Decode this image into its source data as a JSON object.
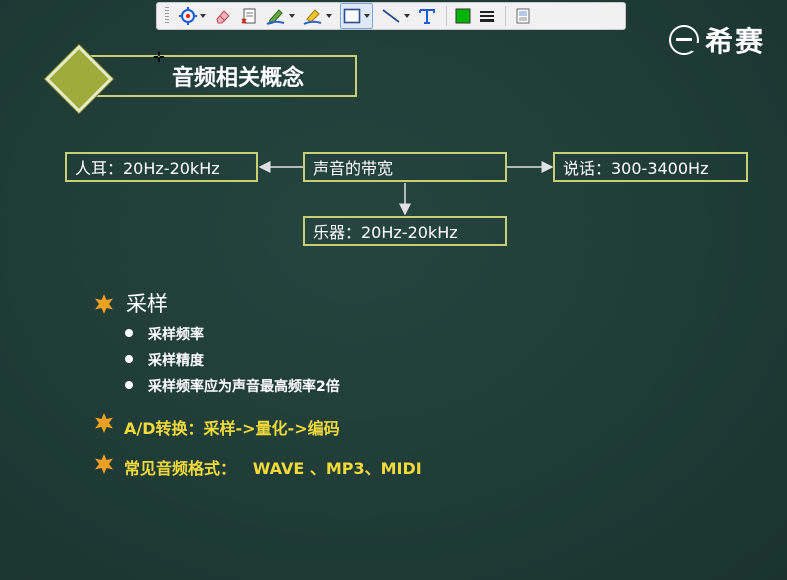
{
  "toolbar": {
    "tools": [
      "pointer-tool",
      "eraser-tool",
      "clear-slide-tool",
      "pen-tool",
      "highlighter-tool",
      "rectangle-tool",
      "line-tool",
      "text-tool",
      "color-swatch",
      "line-weight-tool",
      "screen-capture-tool"
    ],
    "colors": {
      "swatch": "#00b400",
      "accent": "#3b6fd8"
    }
  },
  "logo": {
    "text": "希赛"
  },
  "slide": {
    "title": "音频相关概念",
    "diagram": {
      "center": "声音的带宽",
      "left": "人耳：20Hz-20kHz",
      "right": "说话：300-3400Hz",
      "bottom": "乐器：20Hz-20kHz"
    },
    "sampling": {
      "heading": "采样",
      "items": [
        "采样频率",
        "采样精度",
        "采样频率应为声音最高频率2倍"
      ]
    },
    "ad": "A/D转换：采样->量化->编码",
    "formats": "常见音频格式：   WAVE 、MP3、MIDI"
  },
  "colors": {
    "background": "#1f3b36",
    "border": "#c5cf78",
    "diamond": "#9fac3c",
    "highlight": "#f2da3a",
    "star": "#f0a020"
  }
}
